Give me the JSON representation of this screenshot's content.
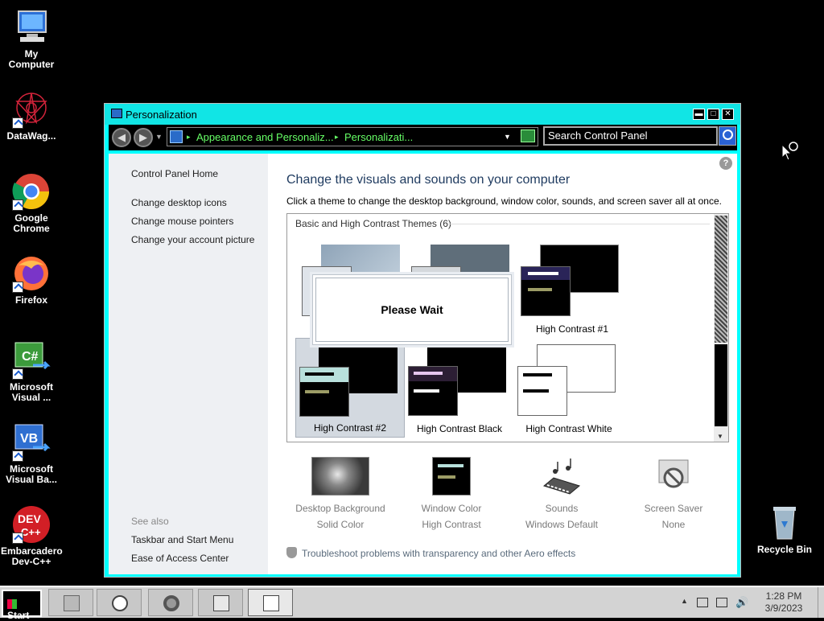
{
  "desktop": {
    "icons": [
      {
        "label": "My Computer"
      },
      {
        "label": "DataWag..."
      },
      {
        "label": "Google Chrome"
      },
      {
        "label": "Firefox"
      },
      {
        "label": "Microsoft Visual ..."
      },
      {
        "label": "Microsoft Visual Ba..."
      },
      {
        "label": "Embarcadero Dev-C++"
      },
      {
        "label": "Recycle Bin"
      }
    ]
  },
  "window": {
    "title": "Personalization",
    "breadcrumb": [
      "Appearance and Personaliz...",
      "Personalizati..."
    ],
    "search_placeholder": "Search Control Panel",
    "sidebar": {
      "home": "Control Panel Home",
      "links": [
        "Change desktop icons",
        "Change mouse pointers",
        "Change your account picture"
      ],
      "see_also_label": "See also",
      "see_also": [
        "Taskbar and Start Menu",
        "Ease of Access Center"
      ]
    },
    "heading": "Change the visuals and sounds on your computer",
    "subheading": "Click a theme to change the desktop background, window color, sounds, and screen saver all at once.",
    "group_title": "Basic and High Contrast Themes (6)",
    "themes": [
      {
        "label": ""
      },
      {
        "label": ""
      },
      {
        "label": "High Contrast #1"
      },
      {
        "label": "High Contrast #2"
      },
      {
        "label": "High Contrast Black"
      },
      {
        "label": "High Contrast White"
      }
    ],
    "wait_dialog": "Please Wait",
    "options": [
      {
        "title": "Desktop Background",
        "value": "Solid Color"
      },
      {
        "title": "Window Color",
        "value": "High Contrast"
      },
      {
        "title": "Sounds",
        "value": "Windows Default"
      },
      {
        "title": "Screen Saver",
        "value": "None"
      }
    ],
    "troubleshoot": "Troubleshoot problems with transparency and other Aero effects"
  },
  "taskbar": {
    "start_label": "Start",
    "time": "1:28 PM",
    "date": "3/9/2023"
  },
  "colors": {
    "titlebar": "#11e5e5",
    "address_text": "#66ff66",
    "desktop": "#000000"
  }
}
